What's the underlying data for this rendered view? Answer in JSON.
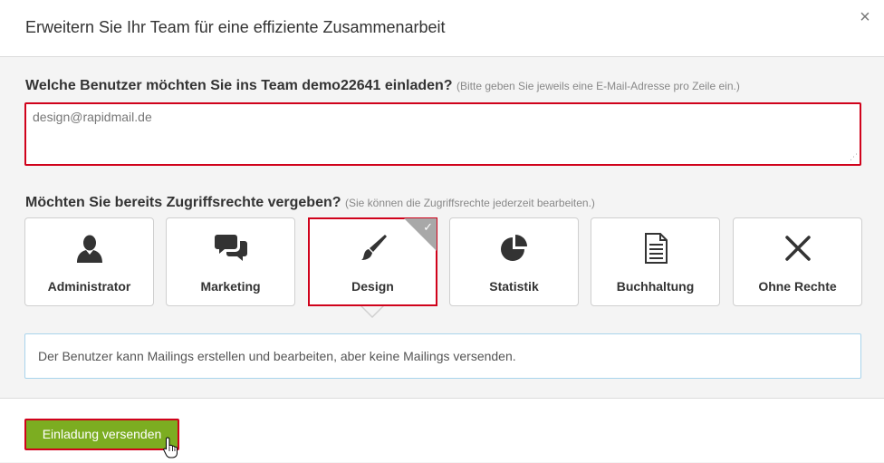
{
  "header": {
    "title": "Erweitern Sie Ihr Team für eine effiziente Zusammenarbeit",
    "close_symbol": "×"
  },
  "invite": {
    "question": "Welche Benutzer möchten Sie ins Team demo22641 einladen?",
    "hint": "(Bitte geben Sie jeweils eine E-Mail-Adresse pro Zeile ein.)",
    "emails_value": "design@rapidmail.de"
  },
  "permissions": {
    "question": "Möchten Sie bereits Zugriffsrechte vergeben?",
    "hint": "(Sie können die Zugriffsrechte jederzeit bearbeiten.)",
    "selected": "Design",
    "roles": [
      {
        "label": "Administrator",
        "icon": "user-icon"
      },
      {
        "label": "Marketing",
        "icon": "chat-bubbles-icon"
      },
      {
        "label": "Design",
        "icon": "paintbrush-icon"
      },
      {
        "label": "Statistik",
        "icon": "pie-chart-icon"
      },
      {
        "label": "Buchhaltung",
        "icon": "document-icon"
      },
      {
        "label": "Ohne Rechte",
        "icon": "x-icon"
      }
    ],
    "description": "Der Benutzer kann Mailings erstellen und bearbeiten, aber keine Mailings versenden."
  },
  "footer": {
    "send_label": "Einladung versenden"
  },
  "colors": {
    "highlight": "#d0021b",
    "button_green": "#7cad21",
    "desc_border": "#a9d4ec",
    "check_corner": "#a8a8a8"
  }
}
